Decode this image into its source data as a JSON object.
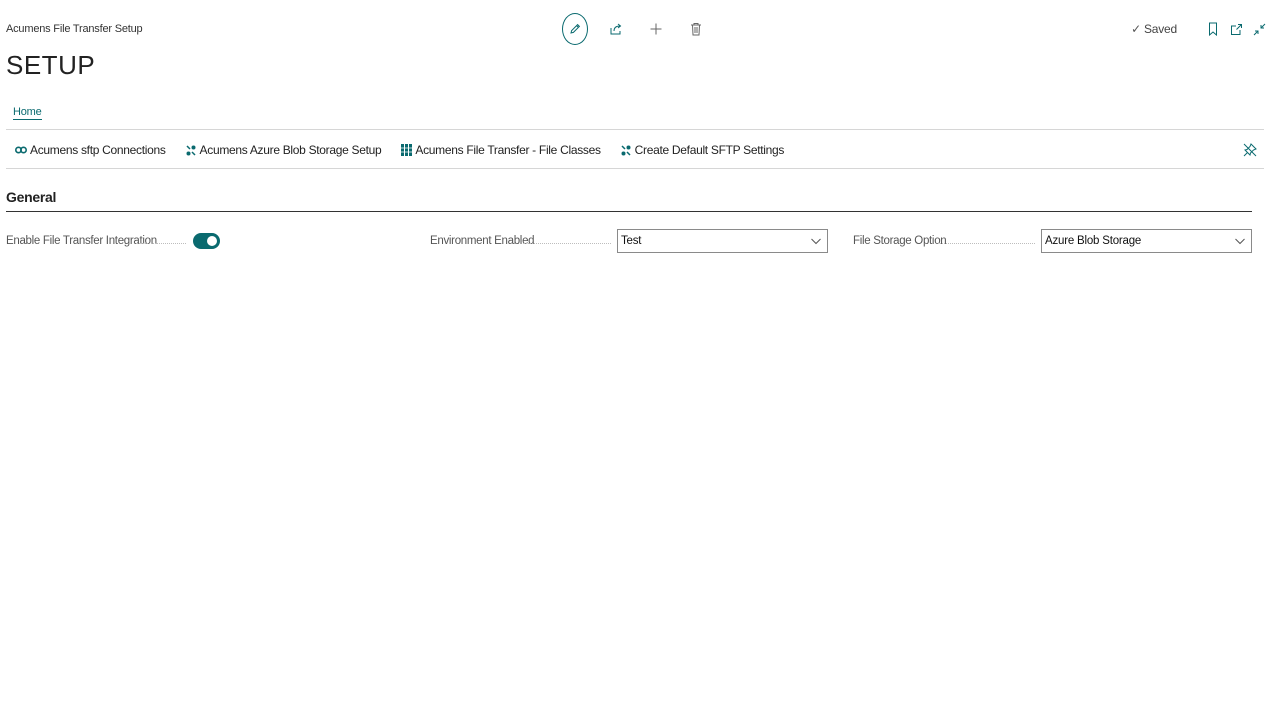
{
  "window": {
    "breadcrumb": "Acumens File Transfer Setup",
    "title": "SETUP",
    "status": "Saved"
  },
  "toolbar": {
    "icons": [
      "edit-pencil-icon",
      "share-icon",
      "add-icon",
      "delete-icon"
    ]
  },
  "top_right_icons": [
    "bookmark-icon",
    "open-new-window-icon",
    "collapse-icon"
  ],
  "tabs": [
    {
      "label": "Home"
    }
  ],
  "actions": [
    {
      "label": "Acumens sftp Connections",
      "icon": "link-icon"
    },
    {
      "label": "Acumens Azure Blob Storage Setup",
      "icon": "setup-icon"
    },
    {
      "label": "Acumens File Transfer - File Classes",
      "icon": "grid-icon"
    },
    {
      "label": "Create Default SFTP Settings",
      "icon": "setup-icon"
    }
  ],
  "section": {
    "title": "General",
    "fields": {
      "enable_integration": {
        "label": "Enable File Transfer Integration",
        "value": true
      },
      "environment": {
        "label": "Environment Enabled",
        "value": "Test"
      },
      "storage": {
        "label": "File Storage Option",
        "value": "Azure Blob Storage"
      }
    }
  },
  "colors": {
    "accent": "#0a6a6f",
    "text": "#212121",
    "divider": "#d6d6d6"
  }
}
